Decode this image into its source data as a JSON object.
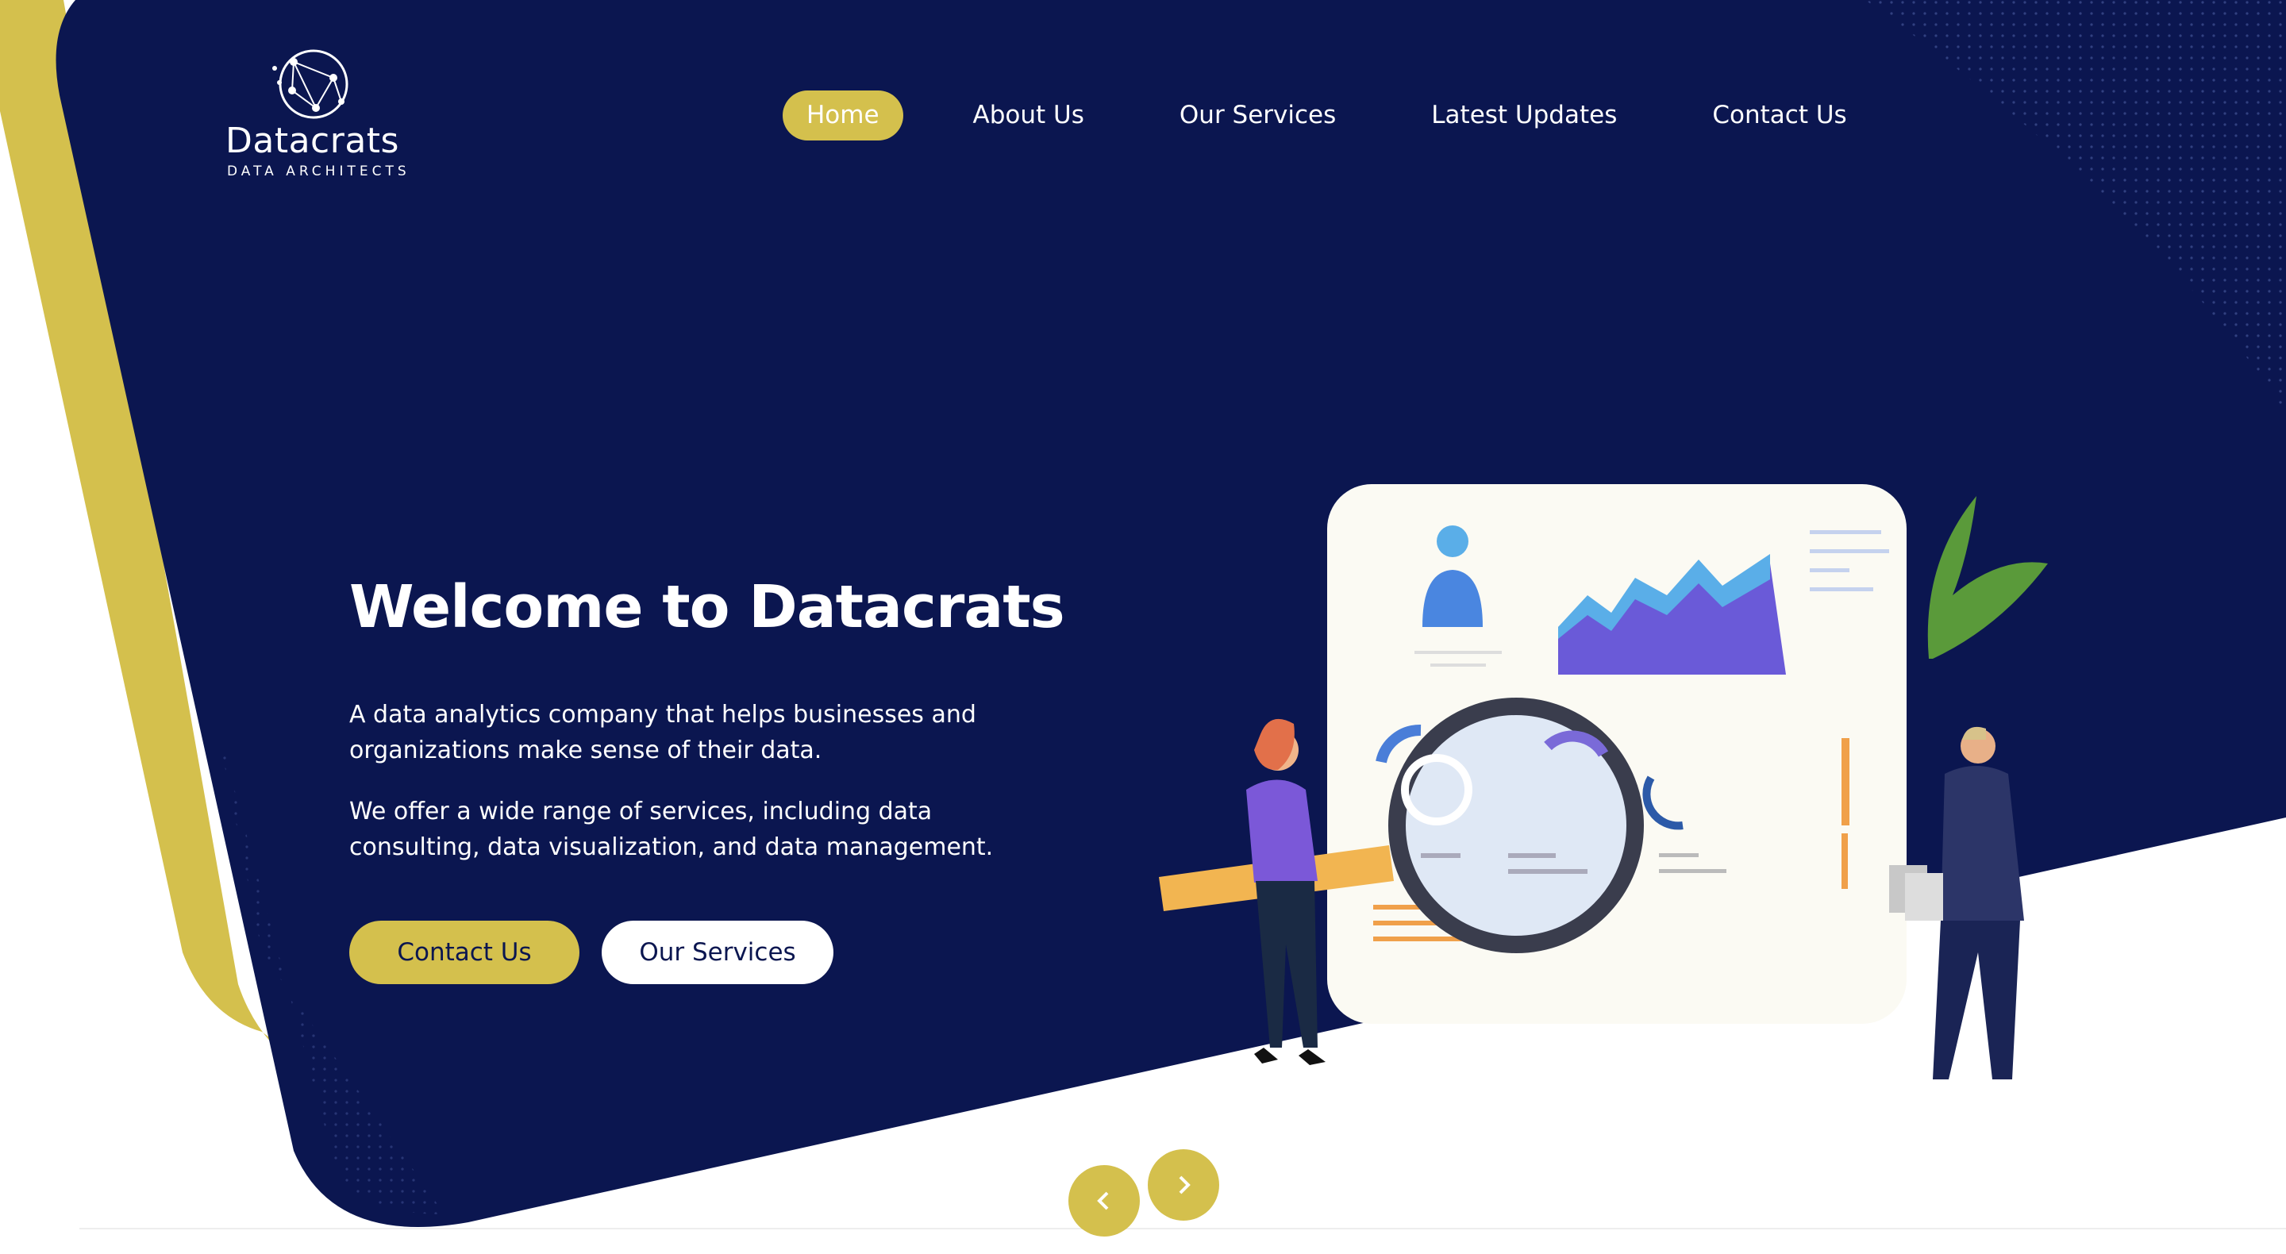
{
  "brand": {
    "name": "Datacrats",
    "tagline": "DATA ARCHITECTS",
    "logo_icon": "network-globe-icon"
  },
  "nav": {
    "items": [
      {
        "label": "Home",
        "active": true
      },
      {
        "label": "About Us",
        "active": false
      },
      {
        "label": "Our Services",
        "active": false
      },
      {
        "label": "Latest Updates",
        "active": false
      },
      {
        "label": "Contact Us",
        "active": false
      }
    ]
  },
  "hero": {
    "title": "Welcome to Datacrats",
    "paragraph1": "A data analytics company that helps businesses and organizations make sense of their data.",
    "paragraph2": "We offer a wide range of services, including data consulting, data visualization, and data management.",
    "primary_button": "Contact Us",
    "secondary_button": "Our Services",
    "illustration": "data-analysis-illustration"
  },
  "carousel": {
    "prev_icon": "chevron-left-icon",
    "next_icon": "chevron-right-icon"
  },
  "colors": {
    "navy": "#0b1650",
    "gold": "#d4c04d",
    "white": "#ffffff"
  }
}
